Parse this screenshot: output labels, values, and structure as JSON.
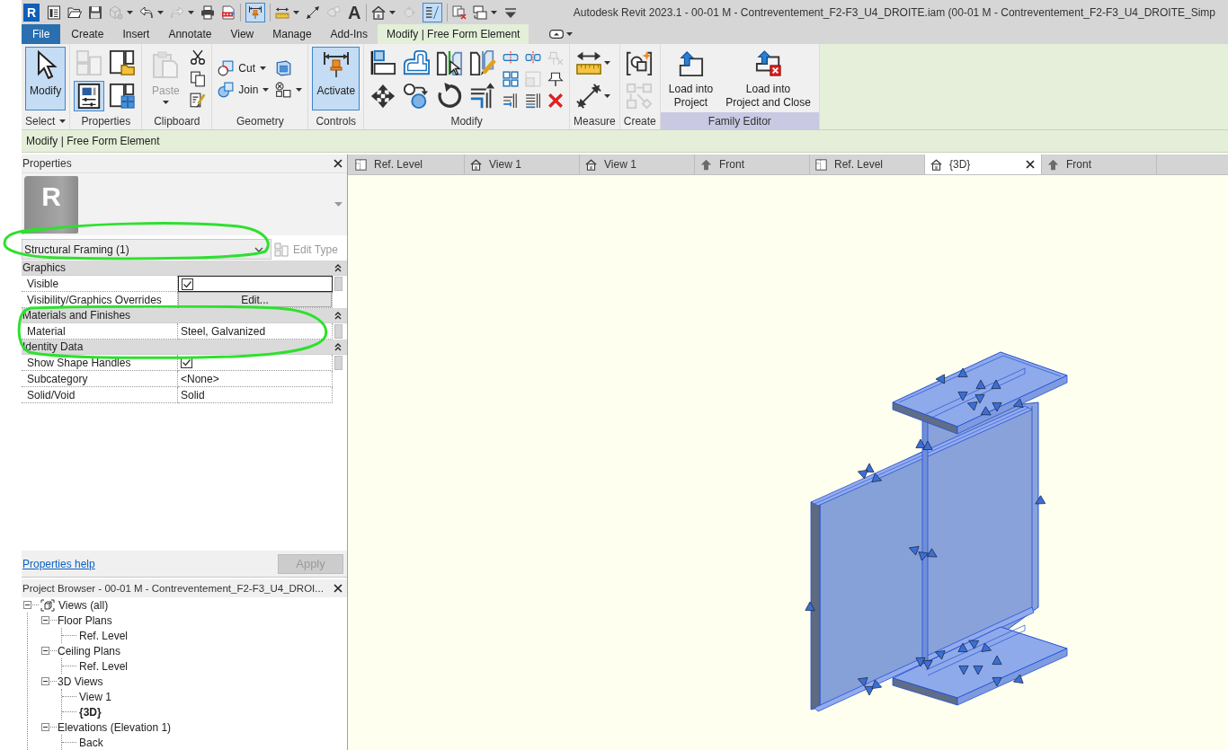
{
  "title": "Autodesk Revit 2023.1 - 00-01 M - Contreventement_F2-F3_U4_DROITE.iam (00-01 M - Contreventement_F2-F3_U4_DROITE_Simp",
  "app_logo": "R",
  "quick_access": [
    [
      {
        "kind": "sheet",
        "pressed": false,
        "disabled": false,
        "dropdown": false
      },
      {
        "kind": "folder",
        "pressed": false,
        "disabled": false,
        "dropdown": false
      },
      {
        "kind": "save",
        "pressed": false,
        "disabled": false,
        "dropdown": false
      },
      {
        "kind": "sync",
        "pressed": false,
        "disabled": true,
        "dropdown": true
      },
      {
        "kind": "undo",
        "pressed": false,
        "disabled": false,
        "dropdown": true
      },
      {
        "kind": "redo",
        "pressed": false,
        "disabled": true,
        "dropdown": true
      },
      {
        "kind": "print",
        "pressed": false,
        "disabled": false,
        "dropdown": false
      },
      {
        "kind": "pdf",
        "pressed": false,
        "disabled": false,
        "dropdown": false
      }
    ],
    [
      {
        "kind": "aligndim",
        "pressed": true,
        "disabled": false,
        "dropdown": false
      }
    ],
    [
      {
        "kind": "ruler",
        "pressed": false,
        "disabled": false,
        "dropdown": true
      },
      {
        "kind": "diagonal",
        "pressed": false,
        "disabled": false,
        "dropdown": false
      },
      {
        "kind": "tag",
        "pressed": false,
        "disabled": true,
        "dropdown": false
      },
      {
        "kind": "text",
        "glyph": "A",
        "pressed": false,
        "disabled": false,
        "dropdown": false
      }
    ],
    [
      {
        "kind": "house",
        "pressed": false,
        "disabled": false,
        "dropdown": true
      },
      {
        "kind": "marker",
        "pressed": false,
        "disabled": true,
        "dropdown": false
      },
      {
        "kind": "thinlines",
        "pressed": true,
        "disabled": false,
        "dropdown": false
      }
    ],
    [
      {
        "kind": "closewin",
        "pressed": false,
        "disabled": false,
        "dropdown": false
      },
      {
        "kind": "switchwin",
        "pressed": false,
        "disabled": false,
        "dropdown": true
      },
      {
        "kind": "customize",
        "pressed": false,
        "disabled": false,
        "dropdown": false
      }
    ]
  ],
  "ribbon_tabs": [
    {
      "label": "File",
      "kind": "file",
      "selected": false
    },
    {
      "label": "Create",
      "kind": "tab",
      "selected": false
    },
    {
      "label": "Insert",
      "kind": "tab",
      "selected": false
    },
    {
      "label": "Annotate",
      "kind": "tab",
      "selected": false
    },
    {
      "label": "View",
      "kind": "tab",
      "selected": false
    },
    {
      "label": "Manage",
      "kind": "tab",
      "selected": false
    },
    {
      "label": "Add-Ins",
      "kind": "tab",
      "selected": false
    },
    {
      "label": "Modify | Free Form Element",
      "kind": "contextual",
      "selected": true
    }
  ],
  "ribbon_panels": [
    {
      "label": "Select",
      "kind": "standard",
      "dropdown": true,
      "columns": [
        {
          "kind": "large",
          "items": [
            {
              "kind": "cursor",
              "label": "Modify",
              "pressed": true,
              "disabled": false,
              "dropdown": false
            }
          ]
        }
      ]
    },
    {
      "label": "Properties",
      "kind": "standard",
      "dropdown": false,
      "columns": [
        {
          "kind": "medium",
          "items": [
            {
              "kind": "typeprops",
              "pressed": false,
              "disabled": true,
              "dropdown": false
            },
            {
              "kind": "properties",
              "pressed": true,
              "disabled": false,
              "dropdown": false
            }
          ]
        },
        {
          "kind": "medium",
          "items": [
            {
              "kind": "familytypes",
              "pressed": false,
              "disabled": false,
              "dropdown": false
            },
            {
              "kind": "windowgrid",
              "pressed": false,
              "disabled": false,
              "dropdown": false
            }
          ]
        }
      ]
    },
    {
      "label": "Clipboard",
      "kind": "standard",
      "dropdown": false,
      "columns": [
        {
          "kind": "large",
          "items": [
            {
              "kind": "paste",
              "label": "Paste",
              "pressed": false,
              "disabled": true,
              "dropdown": true
            }
          ]
        },
        {
          "kind": "small",
          "items": [
            {
              "kind": "scissors",
              "pressed": false,
              "disabled": false,
              "dropdown": false
            },
            {
              "kind": "copy",
              "pressed": false,
              "disabled": false,
              "dropdown": false
            },
            {
              "kind": "brush",
              "pressed": false,
              "disabled": false,
              "dropdown": false
            }
          ]
        }
      ]
    },
    {
      "label": "Geometry",
      "kind": "standard",
      "dropdown": false,
      "columns": [
        {
          "kind": "small",
          "items": [
            {
              "kind": "cut",
              "label": "Cut",
              "pressed": false,
              "disabled": false,
              "dropdown": true
            },
            {
              "kind": "join",
              "label": "Join",
              "pressed": false,
              "disabled": false,
              "dropdown": true
            }
          ]
        },
        {
          "kind": "small",
          "items": [
            {
              "kind": "box",
              "pressed": false,
              "disabled": false,
              "dropdown": false
            },
            {
              "kind": "splitface",
              "pressed": false,
              "disabled": false,
              "dropdown": true
            }
          ]
        }
      ]
    },
    {
      "label": "Controls",
      "kind": "standard",
      "dropdown": false,
      "columns": [
        {
          "kind": "large",
          "items": [
            {
              "kind": "activate",
              "label": "Activate",
              "pressed": true,
              "disabled": false,
              "dropdown": false
            }
          ]
        }
      ]
    },
    {
      "label": "Modify",
      "kind": "standard",
      "dropdown": false,
      "columns": [
        {
          "kind": "medium",
          "items": [
            {
              "kind": "align",
              "pressed": false,
              "disabled": false,
              "dropdown": false
            },
            {
              "kind": "move",
              "pressed": false,
              "disabled": false,
              "dropdown": false
            }
          ]
        },
        {
          "kind": "medium",
          "items": [
            {
              "kind": "offset",
              "pressed": false,
              "disabled": false,
              "dropdown": false
            },
            {
              "kind": "copyobj",
              "pressed": false,
              "disabled": false,
              "dropdown": false
            }
          ]
        },
        {
          "kind": "medium",
          "items": [
            {
              "kind": "mirrorpick",
              "pressed": false,
              "disabled": false,
              "dropdown": false
            },
            {
              "kind": "rotate",
              "pressed": false,
              "disabled": false,
              "dropdown": false
            }
          ]
        },
        {
          "kind": "medium",
          "items": [
            {
              "kind": "mirrordraw",
              "pressed": false,
              "disabled": false,
              "dropdown": false
            },
            {
              "kind": "trimcorner",
              "pressed": false,
              "disabled": false,
              "dropdown": false
            }
          ]
        },
        {
          "kind": "small",
          "items": [
            {
              "kind": "split",
              "pressed": false,
              "disabled": false,
              "dropdown": false
            },
            {
              "kind": "array",
              "pressed": false,
              "disabled": false,
              "dropdown": false
            },
            {
              "kind": "trimsingle",
              "pressed": false,
              "disabled": false,
              "dropdown": false
            }
          ]
        },
        {
          "kind": "small",
          "items": [
            {
              "kind": "splitgap",
              "pressed": false,
              "disabled": false,
              "dropdown": false
            },
            {
              "kind": "scale",
              "pressed": false,
              "disabled": true,
              "dropdown": false
            },
            {
              "kind": "trimmulti",
              "pressed": false,
              "disabled": false,
              "dropdown": false
            }
          ]
        },
        {
          "kind": "small",
          "items": [
            {
              "kind": "unpin",
              "pressed": false,
              "disabled": true,
              "dropdown": false
            },
            {
              "kind": "pin",
              "pressed": false,
              "disabled": false,
              "dropdown": false
            },
            {
              "kind": "delete",
              "pressed": false,
              "disabled": false,
              "dropdown": false
            }
          ]
        }
      ]
    },
    {
      "label": "Measure",
      "kind": "standard",
      "dropdown": false,
      "columns": [
        {
          "kind": "medium",
          "items": [
            {
              "kind": "alignedmeasure",
              "pressed": false,
              "disabled": false,
              "dropdown": true
            },
            {
              "kind": "diagonalmeasure",
              "pressed": false,
              "disabled": false,
              "dropdown": true
            }
          ]
        }
      ]
    },
    {
      "label": "Create",
      "kind": "standard",
      "dropdown": false,
      "columns": [
        {
          "kind": "medium",
          "items": [
            {
              "kind": "creategroup",
              "pressed": false,
              "disabled": false,
              "dropdown": false
            },
            {
              "kind": "createsimilar",
              "pressed": false,
              "disabled": true,
              "dropdown": false
            }
          ]
        }
      ]
    },
    {
      "label": "Family Editor",
      "kind": "editor",
      "dropdown": false,
      "columns": [
        {
          "kind": "large",
          "items": [
            {
              "kind": "load",
              "label": "Load into\nProject",
              "pressed": false,
              "disabled": false,
              "dropdown": false
            },
            {
              "kind": "loadclose",
              "label": "Load into\nProject and Close",
              "pressed": false,
              "disabled": false,
              "dropdown": false
            }
          ]
        }
      ]
    }
  ],
  "options_bar": {
    "label": "Modify | Free Form Element"
  },
  "properties": {
    "title": "Properties",
    "type_image": {
      "glyph": "R"
    },
    "type_selector": {
      "value": "Structural Framing (1)",
      "highlighted": true
    },
    "edit_type": {
      "label": "Edit Type",
      "disabled": true
    },
    "groups": [
      {
        "label": "Graphics",
        "expanded": true,
        "highlighted": false,
        "rows": [
          {
            "name": "Visible",
            "kind": "checkbox",
            "checked": true,
            "active": true,
            "param_button": true
          },
          {
            "name": "Visibility/Graphics Overrides",
            "kind": "button",
            "value": "Edit...",
            "active": false,
            "param_button": false
          }
        ]
      },
      {
        "label": "Materials and Finishes",
        "expanded": true,
        "highlighted": true,
        "rows": [
          {
            "name": "Material",
            "kind": "text",
            "value": "Steel, Galvanized",
            "active": false,
            "param_button": true
          }
        ]
      },
      {
        "label": "Identity Data",
        "expanded": true,
        "highlighted": false,
        "rows": [
          {
            "name": "Show Shape Handles",
            "kind": "checkbox",
            "checked": true,
            "active": false,
            "param_button": true
          },
          {
            "name": "Subcategory",
            "kind": "text",
            "value": "<None>",
            "active": false,
            "param_button": false
          },
          {
            "name": "Solid/Void",
            "kind": "text",
            "value": "Solid",
            "active": false,
            "param_button": false
          }
        ]
      }
    ],
    "help_link": "Properties help",
    "apply": {
      "label": "Apply",
      "disabled": true
    }
  },
  "project_browser": {
    "title": "Project Browser - 00-01 M - Contreventement_F2-F3_U4_DROI...",
    "tree": [
      {
        "label": "Views (all)",
        "kind": "root",
        "expanded": true,
        "children": [
          {
            "label": "Floor Plans",
            "kind": "group",
            "expanded": true,
            "children": [
              {
                "label": "Ref. Level",
                "kind": "view",
                "current": false
              }
            ]
          },
          {
            "label": "Ceiling Plans",
            "kind": "group",
            "expanded": true,
            "children": [
              {
                "label": "Ref. Level",
                "kind": "view",
                "current": false
              }
            ]
          },
          {
            "label": "3D Views",
            "kind": "group",
            "expanded": true,
            "children": [
              {
                "label": "View 1",
                "kind": "view",
                "current": false
              },
              {
                "label": "{3D}",
                "kind": "view",
                "current": true
              }
            ]
          },
          {
            "label": "Elevations (Elevation 1)",
            "kind": "group",
            "expanded": true,
            "children": [
              {
                "label": "Back",
                "kind": "view",
                "current": false
              }
            ]
          }
        ]
      }
    ]
  },
  "view_tabs": [
    {
      "label": "Ref. Level",
      "kind": "plan",
      "selected": false
    },
    {
      "label": "View 1",
      "kind": "perspective",
      "selected": false
    },
    {
      "label": "View 1",
      "kind": "perspective",
      "selected": false
    },
    {
      "label": "Front",
      "kind": "elevation",
      "selected": false
    },
    {
      "label": "Ref. Level",
      "kind": "plan",
      "selected": false
    },
    {
      "label": "{3D}",
      "kind": "perspective",
      "selected": true
    },
    {
      "label": "Front",
      "kind": "elevation",
      "selected": false
    }
  ]
}
